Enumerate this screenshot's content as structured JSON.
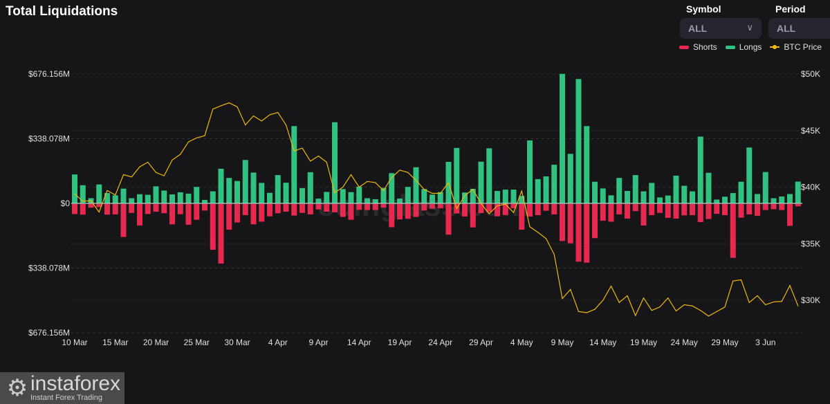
{
  "header": {
    "title": "Total Liquidations"
  },
  "controls": {
    "symbol": {
      "label": "Symbol",
      "value": "ALL"
    },
    "period": {
      "label": "Period",
      "value": "ALL"
    }
  },
  "watermark": "coinglass.com",
  "branding": {
    "name": "instaforex",
    "tagline": "Instant Forex Trading"
  },
  "chart_data": {
    "type": "bar",
    "title": "Total Liquidations",
    "legend": {
      "position": "top-right",
      "entries": [
        "Shorts",
        "Longs",
        "BTC Price"
      ]
    },
    "colors": {
      "shorts": "#e8294f",
      "longs": "#31c281",
      "btc": "#f0b90b"
    },
    "grid": true,
    "x_start": "10 Mar",
    "x_tick_labels": [
      "10 Mar",
      "15 Mar",
      "20 Mar",
      "25 Mar",
      "30 Mar",
      "4 Apr",
      "9 Apr",
      "14 Apr",
      "19 Apr",
      "24 Apr",
      "29 Apr",
      "4 May",
      "9 May",
      "14 May",
      "19 May",
      "24 May",
      "29 May",
      "3 Jun"
    ],
    "left_axis": {
      "unit": "USD millions",
      "range": [
        -676.156,
        676.156
      ],
      "tick_labels": [
        "$676.156M",
        "$338.078M",
        "$0",
        "$338.078M",
        "$676.156M"
      ]
    },
    "right_axis": {
      "unit": "USD thousands",
      "range": [
        26.94,
        50
      ],
      "tick_labels": [
        "$50K",
        "$45K",
        "$40K",
        "$35K",
        "$30K"
      ]
    },
    "series": [
      {
        "name": "Longs",
        "axis": "left",
        "values": [
          151,
          95,
          27,
          99,
          54,
          42,
          77,
          27,
          48,
          45,
          89,
          67,
          47,
          58,
          51,
          86,
          18,
          63,
          181,
          133,
          117,
          227,
          161,
          107,
          55,
          148,
          108,
          404,
          80,
          163,
          25,
          60,
          424,
          75,
          59,
          87,
          27,
          22,
          81,
          158,
          25,
          86,
          189,
          75,
          46,
          59,
          217,
          290,
          57,
          76,
          218,
          288,
          65,
          72,
          72,
          39,
          329,
          127,
          141,
          202,
          677,
          259,
          650,
          404,
          113,
          78,
          42,
          133,
          65,
          148,
          63,
          107,
          31,
          41,
          145,
          92,
          63,
          349,
          160,
          20,
          35,
          54,
          113,
          292,
          49,
          164,
          27,
          36,
          49,
          114
        ]
      },
      {
        "name": "Shorts",
        "axis": "left",
        "values": [
          52,
          55,
          19,
          16,
          55,
          54,
          172,
          46,
          112,
          52,
          40,
          48,
          106,
          53,
          108,
          82,
          34,
          239,
          311,
          134,
          96,
          58,
          106,
          92,
          64,
          48,
          40,
          60,
          46,
          54,
          28,
          40,
          43,
          67,
          82,
          30,
          31,
          31,
          19,
          121,
          80,
          77,
          67,
          34,
          24,
          22,
          160,
          49,
          65,
          122,
          47,
          40,
          64,
          57,
          22,
          134,
          65,
          58,
          35,
          54,
          193,
          205,
          301,
          306,
          178,
          87,
          92,
          54,
          76,
          37,
          112,
          58,
          46,
          72,
          76,
          59,
          58,
          94,
          78,
          51,
          58,
          281,
          71,
          54,
          61,
          31,
          27,
          31,
          114,
          12
        ]
      },
      {
        "name": "BTC Price",
        "axis": "right",
        "values": [
          39.4,
          38.75,
          38.8,
          37.8,
          39.7,
          39.3,
          41.1,
          40.9,
          41.8,
          42.2,
          41.3,
          41.0,
          42.4,
          42.9,
          44.0,
          44.35,
          44.55,
          46.9,
          47.2,
          47.45,
          47.1,
          45.5,
          46.3,
          45.85,
          46.4,
          46.6,
          45.5,
          43.2,
          43.45,
          42.3,
          42.75,
          42.2,
          39.5,
          40.0,
          41.1,
          40.0,
          40.5,
          40.4,
          39.7,
          40.85,
          41.5,
          41.3,
          40.6,
          39.8,
          39.45,
          39.45,
          40.4,
          38.1,
          39.25,
          39.8,
          38.55,
          37.65,
          38.35,
          38.5,
          37.75,
          39.65,
          36.5,
          36.0,
          35.45,
          34.05,
          30.15,
          30.95,
          29.0,
          28.9,
          29.2,
          30.0,
          31.25,
          29.8,
          30.4,
          28.65,
          30.2,
          29.1,
          29.4,
          30.2,
          29.05,
          29.6,
          29.5,
          29.1,
          28.6,
          29.0,
          29.4,
          31.7,
          31.8,
          29.8,
          30.4,
          29.6,
          29.85,
          29.9,
          31.3,
          29.5
        ]
      }
    ]
  }
}
